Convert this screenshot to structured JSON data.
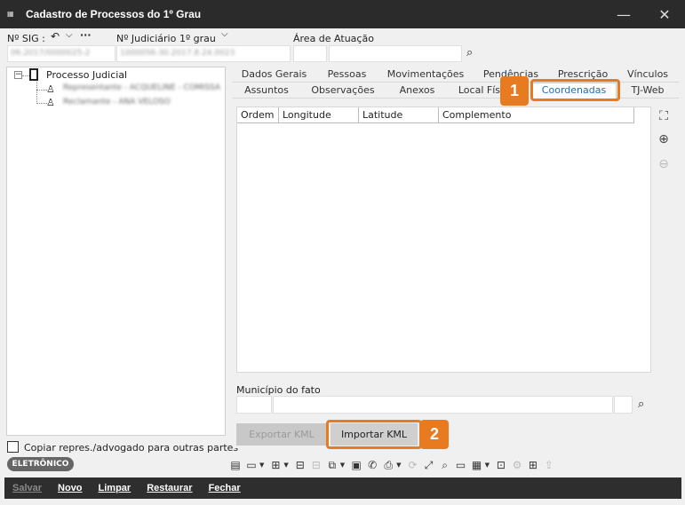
{
  "window": {
    "title": "Cadastro de Processos do 1º Grau",
    "minimize_icon": "minimize-icon",
    "close_icon": "close-icon"
  },
  "header": {
    "sig_label": "Nº SIG :",
    "sig_value": "06.2017/0000025-2",
    "judiciario_label": "Nº Judiciário",
    "grau_label": "1º grau",
    "judiciario_value": "1000056-30.2017.8.24.0023",
    "area_label": "Área de Atuação",
    "area_value": ""
  },
  "tree": {
    "root_label": "Processo Judicial",
    "children": [
      {
        "label": "Representante - ACQUELINE - COMISSA"
      },
      {
        "label": "Reclamante - ANA VELOSO"
      }
    ]
  },
  "copy_checkbox_label": "Copiar repres./advogado para outras partes",
  "badge": "ELETRÔNICO",
  "tabs_row1": [
    "Dados Gerais",
    "Pessoas",
    "Movimentações",
    "Pendências",
    "Prescrição",
    "Vínculos"
  ],
  "tabs_row2": [
    "Assuntos",
    "Observações",
    "Anexos",
    "Local Fís",
    "Coordenadas",
    "TJ-Web"
  ],
  "grid": {
    "columns": [
      "Ordem",
      "Longitude",
      "Latitude",
      "Complemento"
    ],
    "rows": []
  },
  "municipio_label": "Município do fato",
  "buttons": {
    "export_kml": "Exportar KML",
    "import_kml": "Importar KML"
  },
  "callouts": [
    "1",
    "2"
  ],
  "bottom_actions": [
    "Salvar",
    "Novo",
    "Limpar",
    "Restaurar",
    "Fechar"
  ],
  "accent_color": "#e87b1f",
  "active_tab_color": "#1a6fc0"
}
